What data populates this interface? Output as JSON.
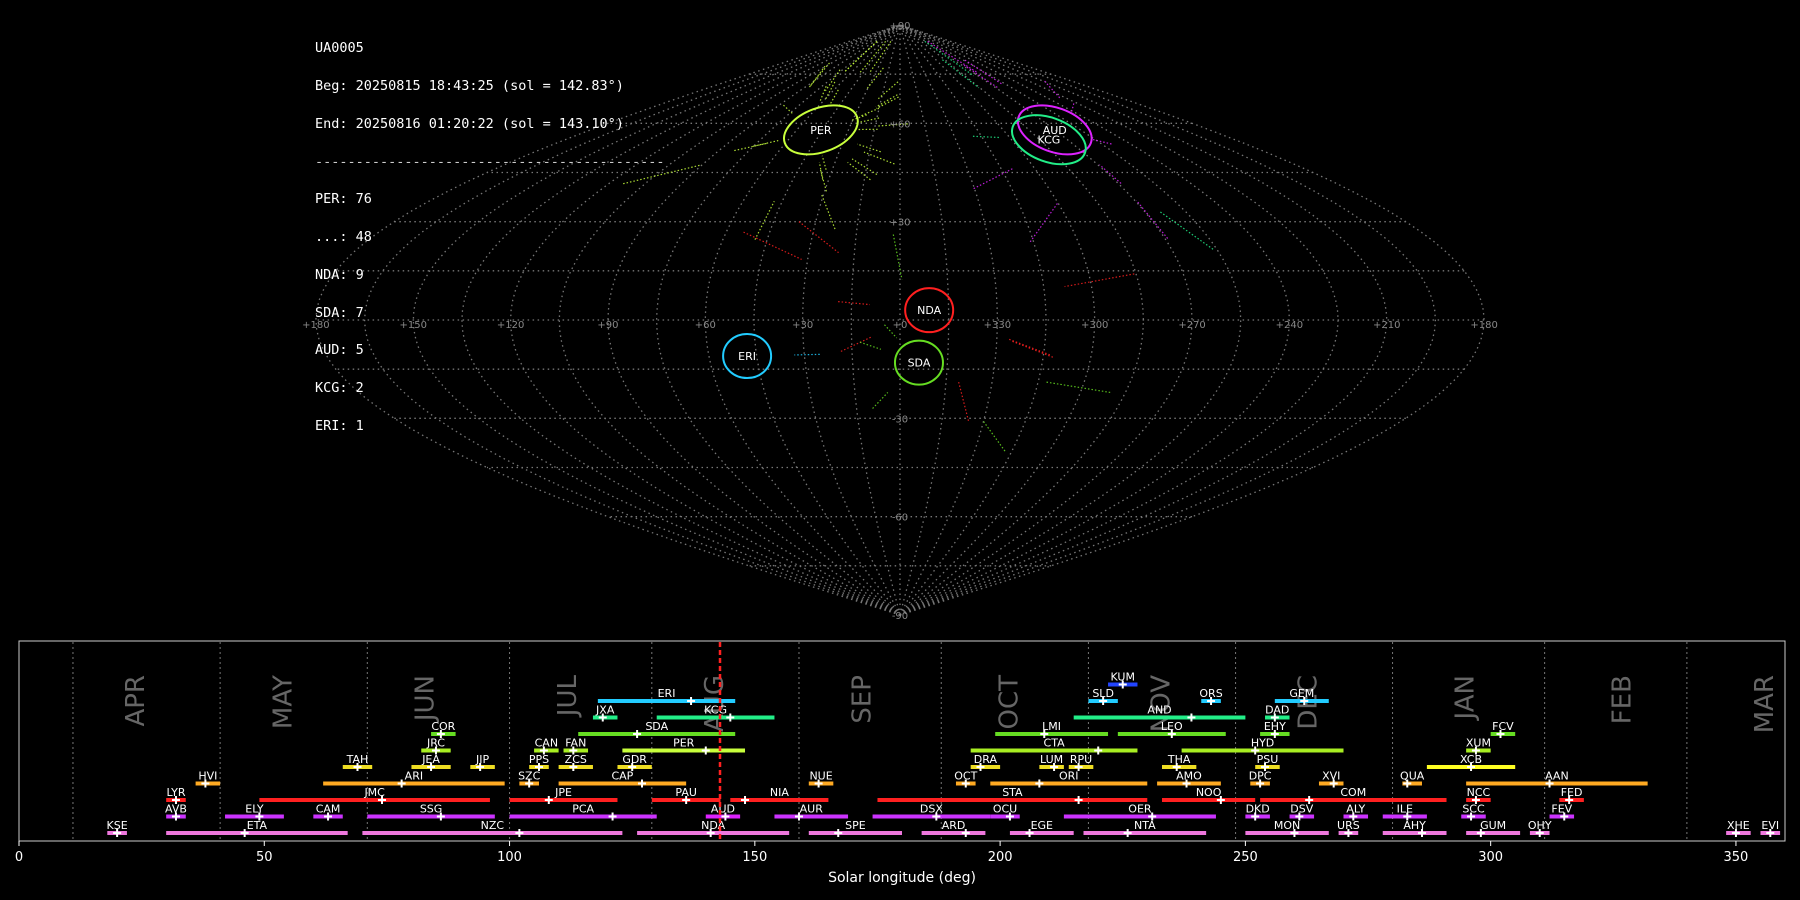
{
  "observation": {
    "camera": "UA0005",
    "begin": "Beg: 20250815 18:43:25 (sol = 142.83°)",
    "end": "End: 20250816 01:20:22 (sol = 143.10°)",
    "separator": "-------------------------------------------",
    "counts": [
      {
        "label": "PER: 76",
        "code": "PER",
        "n": 76
      },
      {
        "label": "...: 48",
        "code": "...",
        "n": 48
      },
      {
        "label": "NDA: 9",
        "code": "NDA",
        "n": 9
      },
      {
        "label": "SDA: 7",
        "code": "SDA",
        "n": 7
      },
      {
        "label": "AUD: 5",
        "code": "AUD",
        "n": 5
      },
      {
        "label": "KCG: 2",
        "code": "KCG",
        "n": 2
      },
      {
        "label": "ERI: 1",
        "code": "ERI",
        "n": 1
      }
    ]
  },
  "chart_data": [
    {
      "type": "scatter",
      "projection": "sinusoidal",
      "lon_labels": [
        "+180",
        "+150",
        "+120",
        "+90",
        "+60",
        "+30",
        "+0",
        "+330",
        "+300",
        "+270",
        "+240",
        "+210",
        "+180"
      ],
      "lat_labels": [
        "+90",
        "+60",
        "+30",
        "-30",
        "-60",
        "-90"
      ],
      "radiants": [
        {
          "code": "PER",
          "lon": 46,
          "lat": 58,
          "color": "#c8ff3c"
        },
        {
          "code": "AUD",
          "lon": -90,
          "lat": 58,
          "color": "#dd22ff"
        },
        {
          "code": "KCG",
          "lon": -80,
          "lat": 55,
          "color": "#22ee88"
        },
        {
          "code": "NDA",
          "lon": -9,
          "lat": 3,
          "color": "#ff2020"
        },
        {
          "code": "SDA",
          "lon": -6,
          "lat": -13,
          "color": "#66dd22"
        },
        {
          "code": "ERI",
          "lon": 48,
          "lat": -11,
          "color": "#22ccff"
        }
      ],
      "grid": true
    },
    {
      "type": "timeline",
      "xlabel": "Solar longitude (deg)",
      "xlim": [
        0,
        360
      ],
      "x_ticks": [
        "0",
        "50",
        "100",
        "150",
        "200",
        "250",
        "300",
        "350"
      ],
      "current_sol": 142.9,
      "months": [
        {
          "name": "APR",
          "pos": 24
        },
        {
          "name": "MAY",
          "pos": 54
        },
        {
          "name": "JUN",
          "pos": 83
        },
        {
          "name": "JUL",
          "pos": 112
        },
        {
          "name": "AUG",
          "pos": 142
        },
        {
          "name": "SEP",
          "pos": 172
        },
        {
          "name": "OCT",
          "pos": 202
        },
        {
          "name": "NOV",
          "pos": 233
        },
        {
          "name": "DEC",
          "pos": 263
        },
        {
          "name": "JAN",
          "pos": 295
        },
        {
          "name": "FEB",
          "pos": 327
        },
        {
          "name": "MAR",
          "pos": 356
        }
      ],
      "month_boundaries": [
        11,
        41,
        71,
        100,
        129,
        159,
        188,
        218,
        248,
        280,
        311,
        340
      ],
      "showers": [
        {
          "code": "KUM",
          "s": 222,
          "e": 228,
          "peak": 225,
          "row": 9,
          "color": "#2244ff"
        },
        {
          "code": "ERI",
          "s": 118,
          "e": 146,
          "peak": 137,
          "row": 8,
          "color": "#22ccff"
        },
        {
          "code": "SLD",
          "s": 218,
          "e": 224,
          "peak": 221,
          "row": 8,
          "color": "#22ccff"
        },
        {
          "code": "ORS",
          "s": 241,
          "e": 245,
          "peak": 243,
          "row": 8,
          "color": "#22ccff"
        },
        {
          "code": "GEM",
          "s": 256,
          "e": 267,
          "peak": 262,
          "row": 8,
          "color": "#22ccff"
        },
        {
          "code": "JXA",
          "s": 117,
          "e": 122,
          "peak": 119,
          "row": 7,
          "color": "#22ee88"
        },
        {
          "code": "KCG",
          "s": 130,
          "e": 154,
          "peak": 145,
          "row": 7,
          "color": "#22ee88"
        },
        {
          "code": "AND",
          "s": 215,
          "e": 250,
          "peak": 239,
          "row": 7,
          "color": "#22ee88"
        },
        {
          "code": "DAD",
          "s": 254,
          "e": 259,
          "peak": 256,
          "row": 7,
          "color": "#22ee88"
        },
        {
          "code": "SDA",
          "s": 114,
          "e": 146,
          "peak": 126,
          "row": 6,
          "color": "#66dd22"
        },
        {
          "code": "COR",
          "s": 84,
          "e": 89,
          "peak": 86,
          "row": 6,
          "color": "#66dd22"
        },
        {
          "code": "LMI",
          "s": 199,
          "e": 222,
          "peak": 209,
          "row": 6,
          "color": "#66dd22"
        },
        {
          "code": "LEO",
          "s": 224,
          "e": 246,
          "peak": 235,
          "row": 6,
          "color": "#66dd22"
        },
        {
          "code": "EHY",
          "s": 253,
          "e": 259,
          "peak": 256,
          "row": 6,
          "color": "#66dd22"
        },
        {
          "code": "FCV",
          "s": 300,
          "e": 305,
          "peak": 302,
          "row": 6,
          "color": "#66dd22"
        },
        {
          "code": "JRC",
          "s": 82,
          "e": 88,
          "peak": 85,
          "row": 5,
          "color": "#a8ee22"
        },
        {
          "code": "CAN",
          "s": 105,
          "e": 110,
          "peak": 107,
          "row": 5,
          "color": "#a8ee22"
        },
        {
          "code": "FAN",
          "s": 111,
          "e": 116,
          "peak": 113,
          "row": 5,
          "color": "#a8ee22"
        },
        {
          "code": "PER",
          "s": 123,
          "e": 148,
          "peak": 140,
          "row": 5,
          "color": "#c8ff3c"
        },
        {
          "code": "CTA",
          "s": 194,
          "e": 228,
          "peak": 220,
          "row": 5,
          "color": "#a8ee22"
        },
        {
          "code": "HYD",
          "s": 237,
          "e": 270,
          "peak": 252,
          "row": 5,
          "color": "#a8ee22"
        },
        {
          "code": "XUM",
          "s": 295,
          "e": 300,
          "peak": 297,
          "row": 5,
          "color": "#a8ee22"
        },
        {
          "code": "TAH",
          "s": 66,
          "e": 72,
          "peak": 69,
          "row": 4,
          "color": "#eedd22"
        },
        {
          "code": "JEA",
          "s": 80,
          "e": 88,
          "peak": 84,
          "row": 4,
          "color": "#eedd22"
        },
        {
          "code": "JIP",
          "s": 92,
          "e": 97,
          "peak": 94,
          "row": 4,
          "color": "#eedd22"
        },
        {
          "code": "PPS",
          "s": 104,
          "e": 108,
          "peak": 106,
          "row": 4,
          "color": "#eedd22"
        },
        {
          "code": "ZCS",
          "s": 110,
          "e": 117,
          "peak": 113,
          "row": 4,
          "color": "#eedd22"
        },
        {
          "code": "GDR",
          "s": 122,
          "e": 129,
          "peak": 125,
          "row": 4,
          "color": "#eedd22"
        },
        {
          "code": "DRA",
          "s": 194,
          "e": 200,
          "peak": 196,
          "row": 4,
          "color": "#eedd22"
        },
        {
          "code": "LUM",
          "s": 208,
          "e": 213,
          "peak": 211,
          "row": 4,
          "color": "#eedd22"
        },
        {
          "code": "RPU",
          "s": 214,
          "e": 219,
          "peak": 216,
          "row": 4,
          "color": "#eedd22"
        },
        {
          "code": "THA",
          "s": 233,
          "e": 240,
          "peak": 236,
          "row": 4,
          "color": "#eedd22"
        },
        {
          "code": "PSU",
          "s": 252,
          "e": 257,
          "peak": 254,
          "row": 4,
          "color": "#eedd22"
        },
        {
          "code": "XCB",
          "s": 287,
          "e": 305,
          "peak": 296,
          "row": 4,
          "color": "#ffff22"
        },
        {
          "code": "HVI",
          "s": 36,
          "e": 41,
          "peak": 38,
          "row": 3,
          "color": "#ffaa22"
        },
        {
          "code": "ARI",
          "s": 62,
          "e": 99,
          "peak": 78,
          "row": 3,
          "color": "#ffaa22"
        },
        {
          "code": "SZC",
          "s": 102,
          "e": 106,
          "peak": 104,
          "row": 3,
          "color": "#ffaa22"
        },
        {
          "code": "CAP",
          "s": 110,
          "e": 136,
          "peak": 127,
          "row": 3,
          "color": "#ffaa22"
        },
        {
          "code": "NUE",
          "s": 161,
          "e": 166,
          "peak": 163,
          "row": 3,
          "color": "#ffaa22"
        },
        {
          "code": "OCT",
          "s": 191,
          "e": 195,
          "peak": 193,
          "row": 3,
          "color": "#ffaa22"
        },
        {
          "code": "ORI",
          "s": 198,
          "e": 230,
          "peak": 208,
          "row": 3,
          "color": "#ffaa22"
        },
        {
          "code": "AMO",
          "s": 232,
          "e": 245,
          "peak": 238,
          "row": 3,
          "color": "#ffaa22"
        },
        {
          "code": "DPC",
          "s": 251,
          "e": 255,
          "peak": 253,
          "row": 3,
          "color": "#ffaa22"
        },
        {
          "code": "XVI",
          "s": 265,
          "e": 270,
          "peak": 268,
          "row": 3,
          "color": "#ffaa22"
        },
        {
          "code": "QUA",
          "s": 282,
          "e": 286,
          "peak": 283,
          "row": 3,
          "color": "#ffaa22"
        },
        {
          "code": "AAN",
          "s": 295,
          "e": 332,
          "peak": 312,
          "row": 3,
          "color": "#ffaa22"
        },
        {
          "code": "LYR",
          "s": 30,
          "e": 34,
          "peak": 32,
          "row": 2,
          "color": "#ff2020"
        },
        {
          "code": "JMC",
          "s": 49,
          "e": 96,
          "peak": 74,
          "row": 2,
          "color": "#ff2020"
        },
        {
          "code": "JPE",
          "s": 100,
          "e": 122,
          "peak": 108,
          "row": 2,
          "color": "#ff2020"
        },
        {
          "code": "PAU",
          "s": 129,
          "e": 143,
          "peak": 136,
          "row": 2,
          "color": "#ff2020"
        },
        {
          "code": "NIA",
          "s": 145,
          "e": 165,
          "peak": 148,
          "row": 2,
          "color": "#ff2020"
        },
        {
          "code": "STA",
          "s": 175,
          "e": 230,
          "peak": 216,
          "row": 2,
          "color": "#ff2020"
        },
        {
          "code": "NOO",
          "s": 233,
          "e": 252,
          "peak": 245,
          "row": 2,
          "color": "#ff2020"
        },
        {
          "code": "COM",
          "s": 253,
          "e": 291,
          "peak": 263,
          "row": 2,
          "color": "#ff2020"
        },
        {
          "code": "NCC",
          "s": 295,
          "e": 300,
          "peak": 297,
          "row": 2,
          "color": "#ff2020"
        },
        {
          "code": "FED",
          "s": 314,
          "e": 319,
          "peak": 316,
          "row": 2,
          "color": "#ff2020"
        },
        {
          "code": "AVB",
          "s": 30,
          "e": 34,
          "peak": 32,
          "row": 1,
          "color": "#cc33ff"
        },
        {
          "code": "ELY",
          "s": 42,
          "e": 54,
          "peak": 49,
          "row": 1,
          "color": "#cc33ff"
        },
        {
          "code": "CAM",
          "s": 60,
          "e": 66,
          "peak": 63,
          "row": 1,
          "color": "#cc33ff"
        },
        {
          "code": "SSG",
          "s": 71,
          "e": 97,
          "peak": 86,
          "row": 1,
          "color": "#cc33ff"
        },
        {
          "code": "PCA",
          "s": 100,
          "e": 130,
          "peak": 121,
          "row": 1,
          "color": "#cc33ff"
        },
        {
          "code": "AUD",
          "s": 140,
          "e": 147,
          "peak": 144,
          "row": 1,
          "color": "#dd22ff"
        },
        {
          "code": "AUR",
          "s": 154,
          "e": 169,
          "peak": 159,
          "row": 1,
          "color": "#cc33ff"
        },
        {
          "code": "DSX",
          "s": 174,
          "e": 198,
          "peak": 187,
          "row": 1,
          "color": "#cc33ff"
        },
        {
          "code": "OCU",
          "s": 198,
          "e": 204,
          "peak": 202,
          "row": 1,
          "color": "#cc33ff"
        },
        {
          "code": "OER",
          "s": 213,
          "e": 244,
          "peak": 231,
          "row": 1,
          "color": "#cc33ff"
        },
        {
          "code": "DKD",
          "s": 250,
          "e": 255,
          "peak": 252,
          "row": 1,
          "color": "#cc33ff"
        },
        {
          "code": "DSV",
          "s": 259,
          "e": 264,
          "peak": 261,
          "row": 1,
          "color": "#cc33ff"
        },
        {
          "code": "ALY",
          "s": 270,
          "e": 275,
          "peak": 272,
          "row": 1,
          "color": "#cc33ff"
        },
        {
          "code": "ILE",
          "s": 278,
          "e": 287,
          "peak": 283,
          "row": 1,
          "color": "#cc33ff"
        },
        {
          "code": "SCC",
          "s": 294,
          "e": 299,
          "peak": 296,
          "row": 1,
          "color": "#cc33ff"
        },
        {
          "code": "FEV",
          "s": 312,
          "e": 317,
          "peak": 315,
          "row": 1,
          "color": "#cc33ff"
        },
        {
          "code": "KSE",
          "s": 18,
          "e": 22,
          "peak": 20,
          "row": 0,
          "color": "#ee77dd"
        },
        {
          "code": "ETA",
          "s": 30,
          "e": 67,
          "peak": 46,
          "row": 0,
          "color": "#ee77dd"
        },
        {
          "code": "NZC",
          "s": 70,
          "e": 123,
          "peak": 102,
          "row": 0,
          "color": "#ee77dd"
        },
        {
          "code": "NDA",
          "s": 126,
          "e": 157,
          "peak": 141,
          "row": 0,
          "color": "#ee77dd"
        },
        {
          "code": "SPE",
          "s": 161,
          "e": 180,
          "peak": 167,
          "row": 0,
          "color": "#ee77dd"
        },
        {
          "code": "ARD",
          "s": 184,
          "e": 197,
          "peak": 193,
          "row": 0,
          "color": "#ee77dd"
        },
        {
          "code": "EGE",
          "s": 202,
          "e": 215,
          "peak": 206,
          "row": 0,
          "color": "#ee77dd"
        },
        {
          "code": "NTA",
          "s": 217,
          "e": 242,
          "peak": 226,
          "row": 0,
          "color": "#ee77dd"
        },
        {
          "code": "MON",
          "s": 250,
          "e": 267,
          "peak": 260,
          "row": 0,
          "color": "#ee77dd"
        },
        {
          "code": "URS",
          "s": 269,
          "e": 273,
          "peak": 271,
          "row": 0,
          "color": "#ee77dd"
        },
        {
          "code": "AHY",
          "s": 278,
          "e": 291,
          "peak": 286,
          "row": 0,
          "color": "#ee77dd"
        },
        {
          "code": "GUM",
          "s": 295,
          "e": 306,
          "peak": 298,
          "row": 0,
          "color": "#ee77dd"
        },
        {
          "code": "OHY",
          "s": 308,
          "e": 312,
          "peak": 310,
          "row": 0,
          "color": "#ee77dd"
        },
        {
          "code": "XHE",
          "s": 348,
          "e": 353,
          "peak": 350,
          "row": 0,
          "color": "#ee77dd"
        },
        {
          "code": "EVI",
          "s": 355,
          "e": 359,
          "peak": 357,
          "row": 0,
          "color": "#ee77dd"
        }
      ]
    }
  ]
}
